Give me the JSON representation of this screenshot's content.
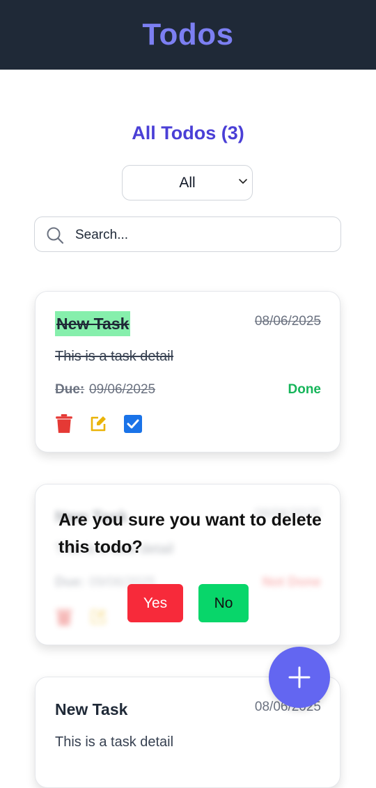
{
  "header": {
    "title": "Todos"
  },
  "list": {
    "title": "All Todos (3)"
  },
  "filter": {
    "selected": "All"
  },
  "search": {
    "placeholder": "Search..."
  },
  "todos": [
    {
      "title": "New Task",
      "date": "08/06/2025",
      "detail": "This is a task detail",
      "due_label": "Due:",
      "due_date": "09/06/2025",
      "status": "Done",
      "completed": true
    },
    {
      "title": "New Task",
      "date": "08/06/2025",
      "detail": "This is a task detail",
      "due_label": "Due:",
      "due_date": "09/06/2025",
      "status": "Not Done",
      "completed": false
    },
    {
      "title": "New Task",
      "date": "08/06/2025",
      "detail": "This is a task detail"
    }
  ],
  "confirm": {
    "message": "Are you sure you want to delete this todo?",
    "yes_label": "Yes",
    "no_label": "No"
  },
  "icons": {
    "delete": "trash-icon",
    "edit": "edit-icon",
    "complete": "checkbox-icon",
    "search": "search-icon",
    "dropdown": "chevron-down-icon",
    "add": "plus-icon"
  },
  "colors": {
    "header_bg": "#1f2937",
    "brand": "#7c7ff2",
    "accent": "#4a3fd6",
    "done": "#16b55a",
    "delete": "#e53935",
    "edit": "#eab308",
    "checkbox": "#1a73e8",
    "yes": "#f72a3a",
    "no": "#08d66a",
    "fab": "#6366f1"
  }
}
